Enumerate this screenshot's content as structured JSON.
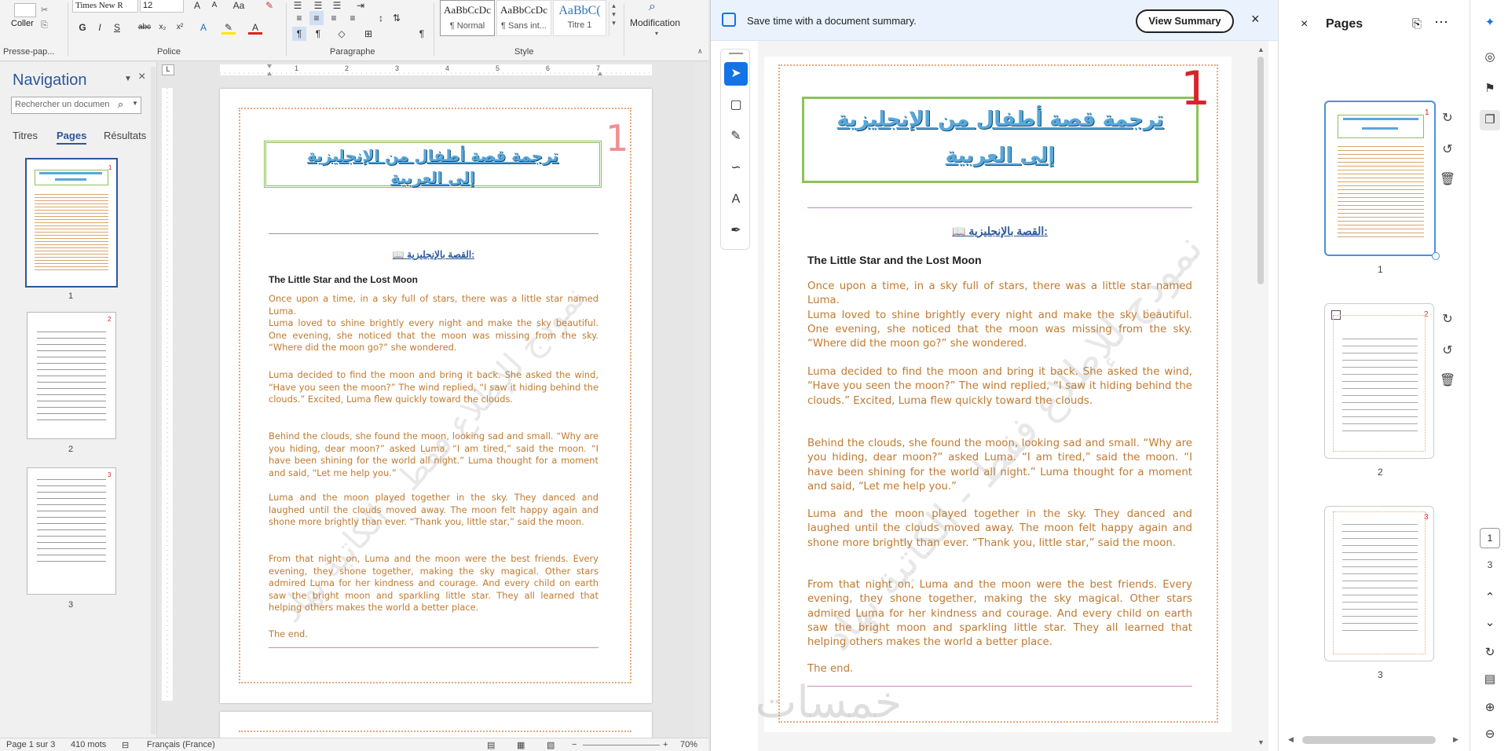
{
  "word": {
    "ribbon": {
      "paste_label": "Coller",
      "clipboard_group": "Presse-pap...",
      "font_name": "Times New R",
      "font_size": "12",
      "font_group": "Police",
      "paragraph_group": "Paragraphe",
      "style_group": "Style",
      "modification_label": "Modification",
      "styles": [
        {
          "preview": "AaBbCcDc",
          "name": "¶ Normal"
        },
        {
          "preview": "AaBbCcDc",
          "name": "¶ Sans int..."
        },
        {
          "preview": "AaBbC(",
          "name": "Titre 1"
        }
      ],
      "font_buttons": [
        "G",
        "I",
        "S",
        "abc",
        "x₂",
        "x²"
      ]
    },
    "nav": {
      "title": "Navigation",
      "search_placeholder": "Rechercher un documen",
      "tabs": [
        "Titres",
        "Pages",
        "Résultats"
      ],
      "thumb_labels": [
        "1",
        "2",
        "3"
      ]
    },
    "ruler_marks": [
      "1",
      "2",
      "3",
      "4",
      "5",
      "6",
      "7"
    ],
    "page": {
      "page_number": "1",
      "ar_title_1": "ترجمة قصة أطفال من الإنجليزية",
      "ar_title_2": "إلى العربية",
      "story_heading": "📖 القصة بالإنجليزية:",
      "story_title": "The Little Star and the Lost Moon",
      "paragraphs": [
        "Once upon a time, in a sky full of stars, there was a little star named Luma.\nLuma loved to shine brightly every night and make the sky beautiful. One evening, she noticed that the moon was missing from the sky. “Where did the moon go?” she wondered.",
        "Luma decided to find the moon and bring it back. She asked the wind, “Have you seen the moon?” The wind replied, “I saw it hiding behind the clouds.” Excited, Luma flew quickly toward the clouds.",
        "Behind the clouds, she found the moon, looking sad and small. “Why are you hiding, dear moon?” asked Luma. “I am tired,” said the moon. “I have been shining for the world all night.” Luma thought for a moment and said, “Let me help you.”",
        "Luma and the moon played together in the sky. They danced and laughed until the clouds moved away. The moon felt happy again and shone more brightly than ever. “Thank you, little star,” said the moon.",
        "From that night on, Luma and the moon were the best friends. Every evening, they shone together, making the sky magical. Other stars admired Luma for her kindness and courage. And every child on earth saw the bright moon and sparkling little star. They all learned that helping others makes the world a better place."
      ],
      "the_end": "The end.",
      "watermark": "نموذج للإطلاع فقط - الكاتبة نهاد"
    },
    "status": {
      "page": "Page 1 sur 3",
      "words": "410 mots",
      "language": "Français (France)",
      "zoom": "70%"
    }
  },
  "acrobat": {
    "banner_text": "Save time with a document summary.",
    "view_summary": "View Summary",
    "pages_title": "Pages",
    "thumb_labels": [
      "1",
      "2",
      "3"
    ],
    "page_counter_current": "1",
    "page_counter_total": "3",
    "bottom_watermark": "خمسات"
  },
  "colors": {
    "accent_blue": "#2b579a",
    "story_text": "#c07a30",
    "title_blue": "#5aa7d8",
    "page_number_red": "#d9242b",
    "frame_green": "#8dc257",
    "acrobat_blue": "#1473e6"
  }
}
